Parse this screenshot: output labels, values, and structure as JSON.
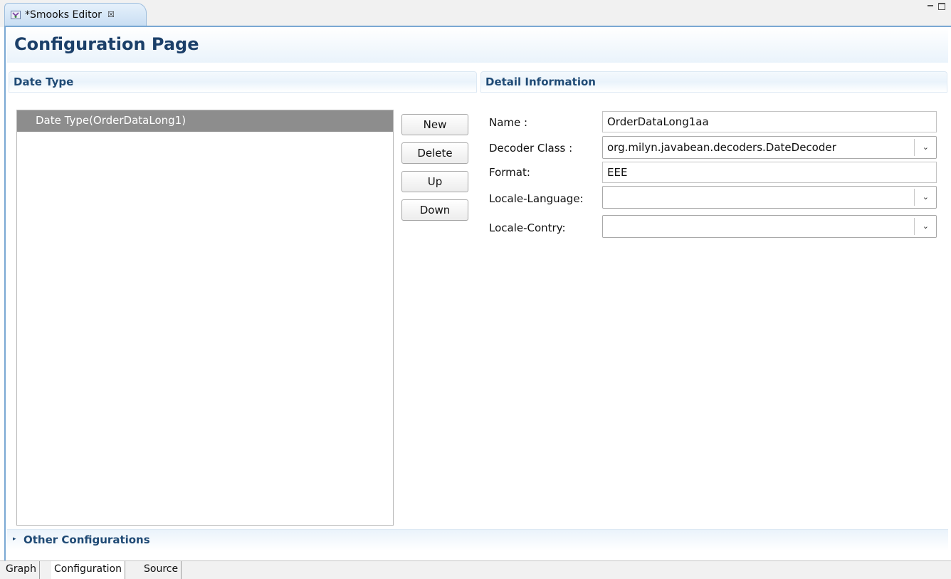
{
  "editor_tab": {
    "title": "*Smooks Editor",
    "close_glyph": "☒",
    "icon": "smooks-editor-icon"
  },
  "window_controls": {
    "minimize_icon": "minimize-icon",
    "maximize_icon": "maximize-icon"
  },
  "page": {
    "title": "Configuration Page"
  },
  "date_type_section": {
    "header": "Date Type",
    "items": [
      {
        "label": "Date Type(OrderDataLong1)",
        "selected": true
      }
    ]
  },
  "buttons": {
    "new": "New",
    "delete": "Delete",
    "up": "Up",
    "down": "Down"
  },
  "detail_section": {
    "header": "Detail Information",
    "name": {
      "label": "Name :",
      "value": "OrderDataLong1aa"
    },
    "decoder_class": {
      "label": "Decoder Class :",
      "value": "org.milyn.javabean.decoders.DateDecoder"
    },
    "format": {
      "label": "Format:",
      "value": "EEE"
    },
    "locale_language": {
      "label": "Locale-Language:",
      "value": ""
    },
    "locale_country": {
      "label": "Locale-Contry:",
      "value": ""
    }
  },
  "other_configurations": {
    "label": "Other Configurations",
    "expand_glyph": "▸"
  },
  "page_tabs": [
    {
      "label": "Graph",
      "active": false
    },
    {
      "label": "Configuration",
      "active": true
    },
    {
      "label": "Source",
      "active": false
    }
  ],
  "chevron_glyph": "⌄",
  "colors": {
    "accent": "#1f4a75",
    "selection": "#8d8d8d",
    "frame_border": "#7aa8d3"
  }
}
